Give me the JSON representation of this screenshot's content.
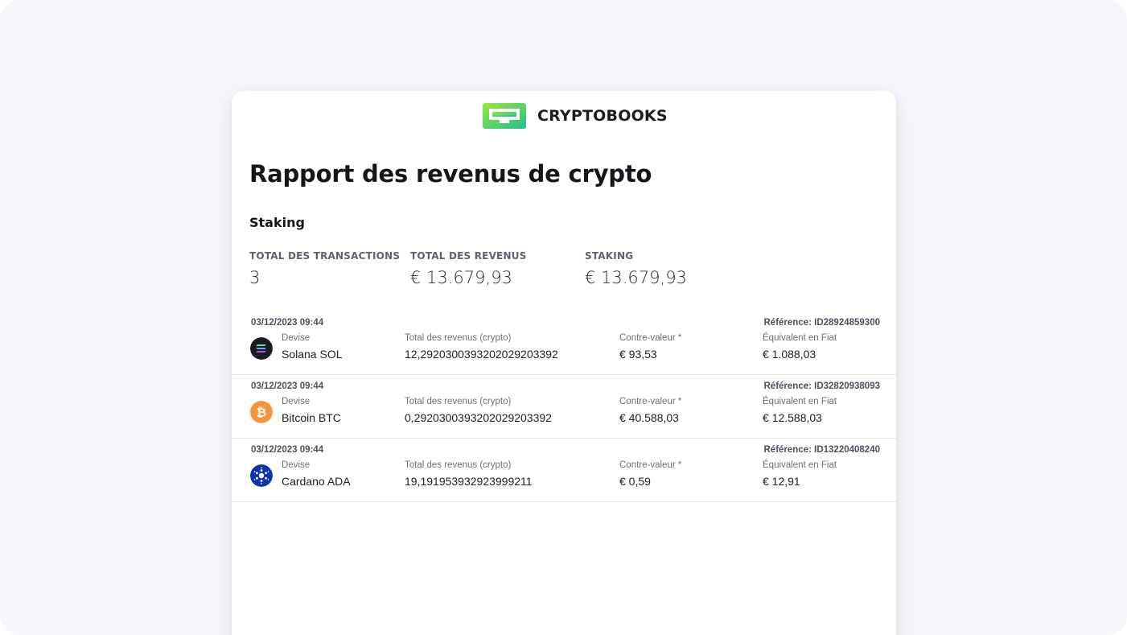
{
  "brand": {
    "name": "CRYPTOBOOKS",
    "logo_colors": [
      "#7dde3c",
      "#27c48f"
    ]
  },
  "report": {
    "title": "Rapport des revenus de crypto",
    "section": "Staking"
  },
  "stats": {
    "total_transactions": {
      "label": "TOTAL DES TRANSACTIONS",
      "value": "3"
    },
    "total_revenue": {
      "label": "TOTAL DES REVENUS",
      "value": "€ 13.679,93"
    },
    "staking": {
      "label": "STAKING",
      "value": "€ 13.679,93"
    }
  },
  "columns": {
    "currency": "Devise",
    "total_crypto": "Total des revenus (crypto)",
    "counter_value": "Contre-valeur *",
    "fiat_equivalent": "Équivalent en Fiat"
  },
  "transactions": [
    {
      "date": "03/12/2023 09:44",
      "reference": "Référence: ID28924859300",
      "currency": "Solana SOL",
      "icon": "solana-icon",
      "icon_color": "#1b1b20",
      "total_crypto": "12,2920300393202029203392",
      "counter_value": "€ 93,53",
      "fiat_equivalent": "€ 1.088,03"
    },
    {
      "date": "03/12/2023 09:44",
      "reference": "Référence: ID32820938093",
      "currency": "Bitcoin BTC",
      "icon": "bitcoin-icon",
      "icon_color": "#f2953d",
      "total_crypto": "0,2920300393202029203392",
      "counter_value": "€ 40.588,03",
      "fiat_equivalent": "€ 12.588,03"
    },
    {
      "date": "03/12/2023 09:44",
      "reference": "Référence: ID13220408240",
      "currency": "Cardano ADA",
      "icon": "cardano-icon",
      "icon_color": "#0d33ad",
      "total_crypto": "19,191953932923999211",
      "counter_value": "€ 0,59",
      "fiat_equivalent": "€ 12,91"
    }
  ]
}
